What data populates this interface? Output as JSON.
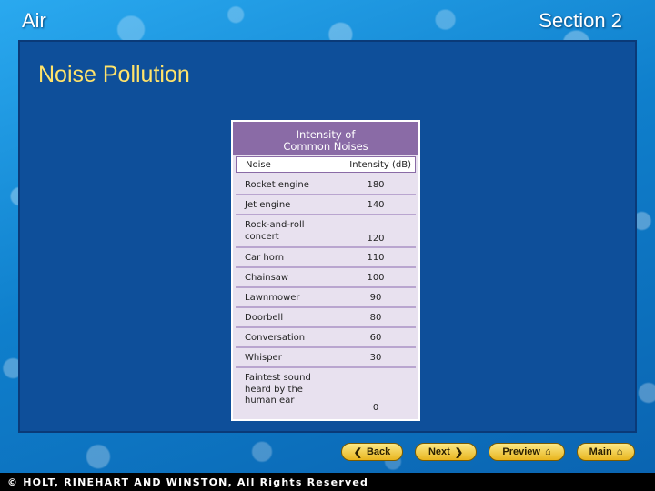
{
  "header": {
    "left_title": "Air",
    "right_title": "Section 2"
  },
  "slide": {
    "title": "Noise Pollution"
  },
  "table": {
    "caption_line1": "Intensity of",
    "caption_line2": "Common Noises",
    "columns": [
      "Noise",
      "Intensity (dB)"
    ],
    "rows": [
      {
        "noise": "Rocket engine",
        "intensity": "180"
      },
      {
        "noise": "Jet engine",
        "intensity": "140"
      },
      {
        "noise": "Rock-and-roll concert",
        "intensity": "120"
      },
      {
        "noise": "Car horn",
        "intensity": "110"
      },
      {
        "noise": "Chainsaw",
        "intensity": "100"
      },
      {
        "noise": "Lawnmower",
        "intensity": "90"
      },
      {
        "noise": "Doorbell",
        "intensity": "80"
      },
      {
        "noise": "Conversation",
        "intensity": "60"
      },
      {
        "noise": "Whisper",
        "intensity": "30"
      },
      {
        "noise": "Faintest sound heard by the human ear",
        "intensity": "0"
      }
    ]
  },
  "nav": {
    "back_label": "Back",
    "next_label": "Next",
    "preview_label": "Preview",
    "main_label": "Main",
    "back_icon": "chevron-left-icon",
    "next_icon": "chevron-right-icon",
    "preview_icon": "house-icon",
    "main_icon": "house-icon"
  },
  "footer": {
    "copyright": "© HOLT, RINEHART AND WINSTON, All Rights Reserved"
  },
  "colors": {
    "title_yellow": "#ffe36a",
    "panel_blue": "#0e4f9a",
    "table_header_purple": "#8a6ba6",
    "button_gold": "#e9b51e"
  }
}
